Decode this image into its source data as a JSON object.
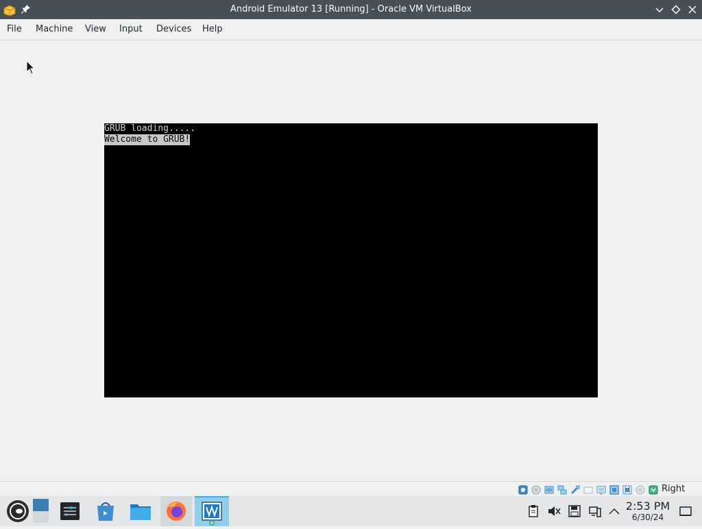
{
  "window": {
    "title": "Android Emulator 13 [Running] - Oracle VM VirtualBox",
    "icons": [
      "virtualbox-app-icon",
      "pin-icon",
      "minimize-icon",
      "maximize-icon",
      "close-icon"
    ]
  },
  "menu": {
    "file": "File",
    "machine": "Machine",
    "view": "View",
    "input": "Input",
    "devices": "Devices",
    "help": "Help"
  },
  "console": {
    "line1": "GRUB loading.....",
    "line2": "Welcome to GRUB!"
  },
  "statusbar": {
    "icons": [
      "hard-disk-icon",
      "optical-drive-icon",
      "audio-icon",
      "network-icon",
      "usb-icon",
      "shared-folders-icon",
      "display-icon",
      "video-capture-icon",
      "cpu-icon",
      "mouse-integration-icon",
      "keyboard-icon"
    ],
    "host_key": "Right Ctrl"
  },
  "taskbar": {
    "items": [
      "application-launcher",
      "desktop-pager",
      "system-settings",
      "discover",
      "file-manager",
      "firefox",
      "virtualbox"
    ],
    "tray_icons": [
      "clipboard-icon",
      "volume-muted-icon",
      "save-icon",
      "network-icon",
      "show-hidden-icon",
      "show-desktop-icon"
    ],
    "clock_time": "2:53 PM",
    "clock_date": "6/30/24"
  },
  "colors": {
    "titlebar": "#475057",
    "background": "#eff0f1",
    "vm_screen": "#000000",
    "accent": "#3daee9"
  }
}
